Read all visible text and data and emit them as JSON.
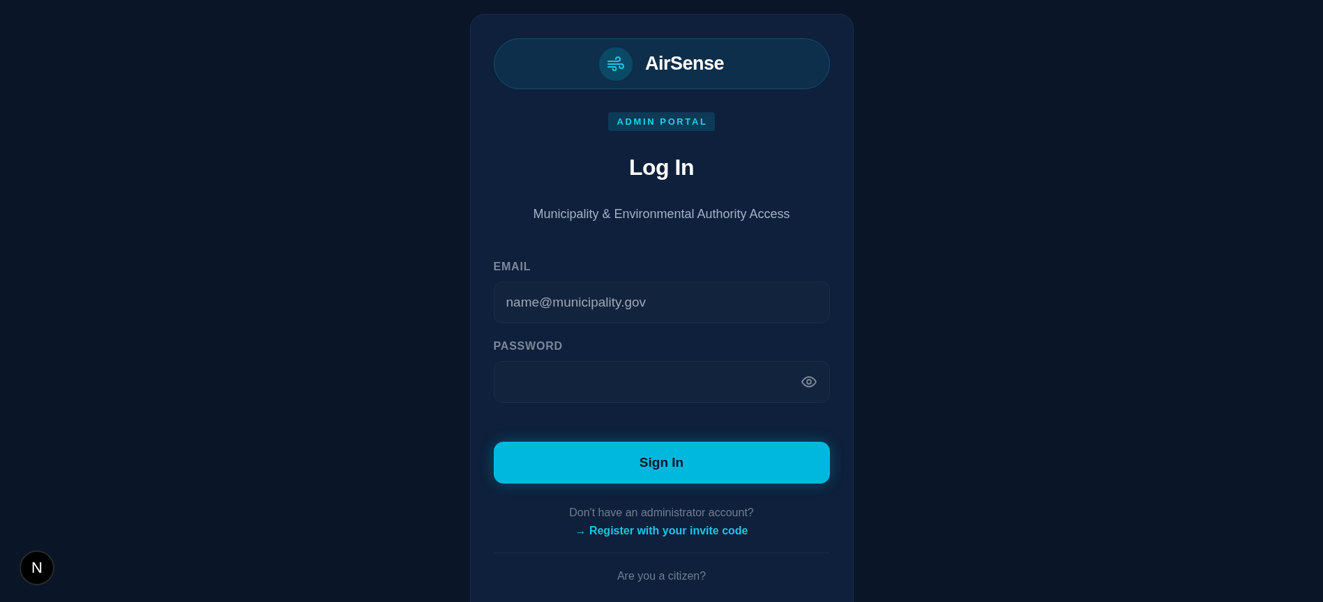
{
  "brand": {
    "name": "AirSense"
  },
  "badge": "ADMIN PORTAL",
  "heading": "Log In",
  "subtitle": "Municipality & Environmental Authority Access",
  "fields": [
    {
      "kind": "email",
      "label": "EMAIL",
      "placeholder": "name@municipality.gov"
    },
    {
      "kind": "password",
      "label": "PASSWORD"
    }
  ],
  "submit": "Sign In",
  "register": {
    "prompt": "Don't have an administrator account?",
    "link": "→ Register with your invite code"
  },
  "citizen": {
    "prompt": "Are you a citizen?"
  },
  "dev_indicator": {
    "label": "N"
  }
}
